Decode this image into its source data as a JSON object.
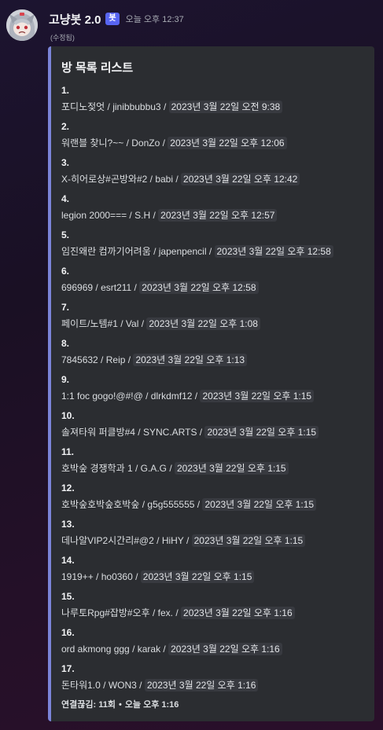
{
  "message": {
    "username": "고냥봇 2.0",
    "bot_badge": "봇",
    "timestamp": "오늘 오후 12:37",
    "edited": "(수정됨)"
  },
  "embed": {
    "accent_color": "#7b84d8",
    "title": "방 목록 리스트",
    "entries": [
      {
        "num": "1.",
        "room": "포디노젖엇",
        "owner": "jinibbubbu3",
        "time": "2023년 3월 22일 오전 9:38"
      },
      {
        "num": "2.",
        "room": "워랜블 찾니?~~",
        "owner": "DonZo",
        "time": "2023년 3월 22일 오후 12:06"
      },
      {
        "num": "3.",
        "room": "X-히어로상#곤방와#2",
        "owner": "babi",
        "time": "2023년 3월 22일 오후 12:42"
      },
      {
        "num": "4.",
        "room": "legion 2000===",
        "owner": "S.H",
        "time": "2023년 3월 22일 오후 12:57"
      },
      {
        "num": "5.",
        "room": "임진왜란 컴까기어려움",
        "owner": "japenpencil",
        "time": "2023년 3월 22일 오후 12:58"
      },
      {
        "num": "6.",
        "room": "696969",
        "owner": "esrt211",
        "time": "2023년 3월 22일 오후 12:58"
      },
      {
        "num": "7.",
        "room": "페이트/노템#1",
        "owner": "Val",
        "time": "2023년 3월 22일 오후 1:08"
      },
      {
        "num": "8.",
        "room": "7845632",
        "owner": "Reip",
        "time": "2023년 3월 22일 오후 1:13"
      },
      {
        "num": "9.",
        "room": "1:1 foc gogo!@#!@",
        "owner": "dlrkdmf12",
        "time": "2023년 3월 22일 오후 1:15"
      },
      {
        "num": "10.",
        "room": "솔져타워 퍼클방#4",
        "owner": "SYNC.ARTS",
        "time": "2023년 3월 22일 오후 1:15"
      },
      {
        "num": "11.",
        "room": "호박숲 경쟁학과 1",
        "owner": "G.A.G",
        "time": "2023년 3월 22일 오후 1:15"
      },
      {
        "num": "12.",
        "room": "호박숲호박숲호박숲",
        "owner": "g5g555555",
        "time": "2023년 3월 22일 오후 1:15"
      },
      {
        "num": "13.",
        "room": "데나알VIP2시간리#@2",
        "owner": "HiHY",
        "time": "2023년 3월 22일 오후 1:15"
      },
      {
        "num": "14.",
        "room": "1919++",
        "owner": "ho0360",
        "time": "2023년 3월 22일 오후 1:15"
      },
      {
        "num": "15.",
        "room": "나루토Rpg#잡방#오후",
        "owner": "fex.",
        "time": "2023년 3월 22일 오후 1:16"
      },
      {
        "num": "16.",
        "room": "ord akmong ggg",
        "owner": "karak",
        "time": "2023년 3월 22일 오후 1:16"
      },
      {
        "num": "17.",
        "room": "돈타워1.0",
        "owner": "WON3",
        "time": "2023년 3월 22일 오후 1:16"
      }
    ],
    "footer": {
      "text": "연결끊김: 11회",
      "dot": "•",
      "time": "오늘 오후 1:16"
    }
  }
}
